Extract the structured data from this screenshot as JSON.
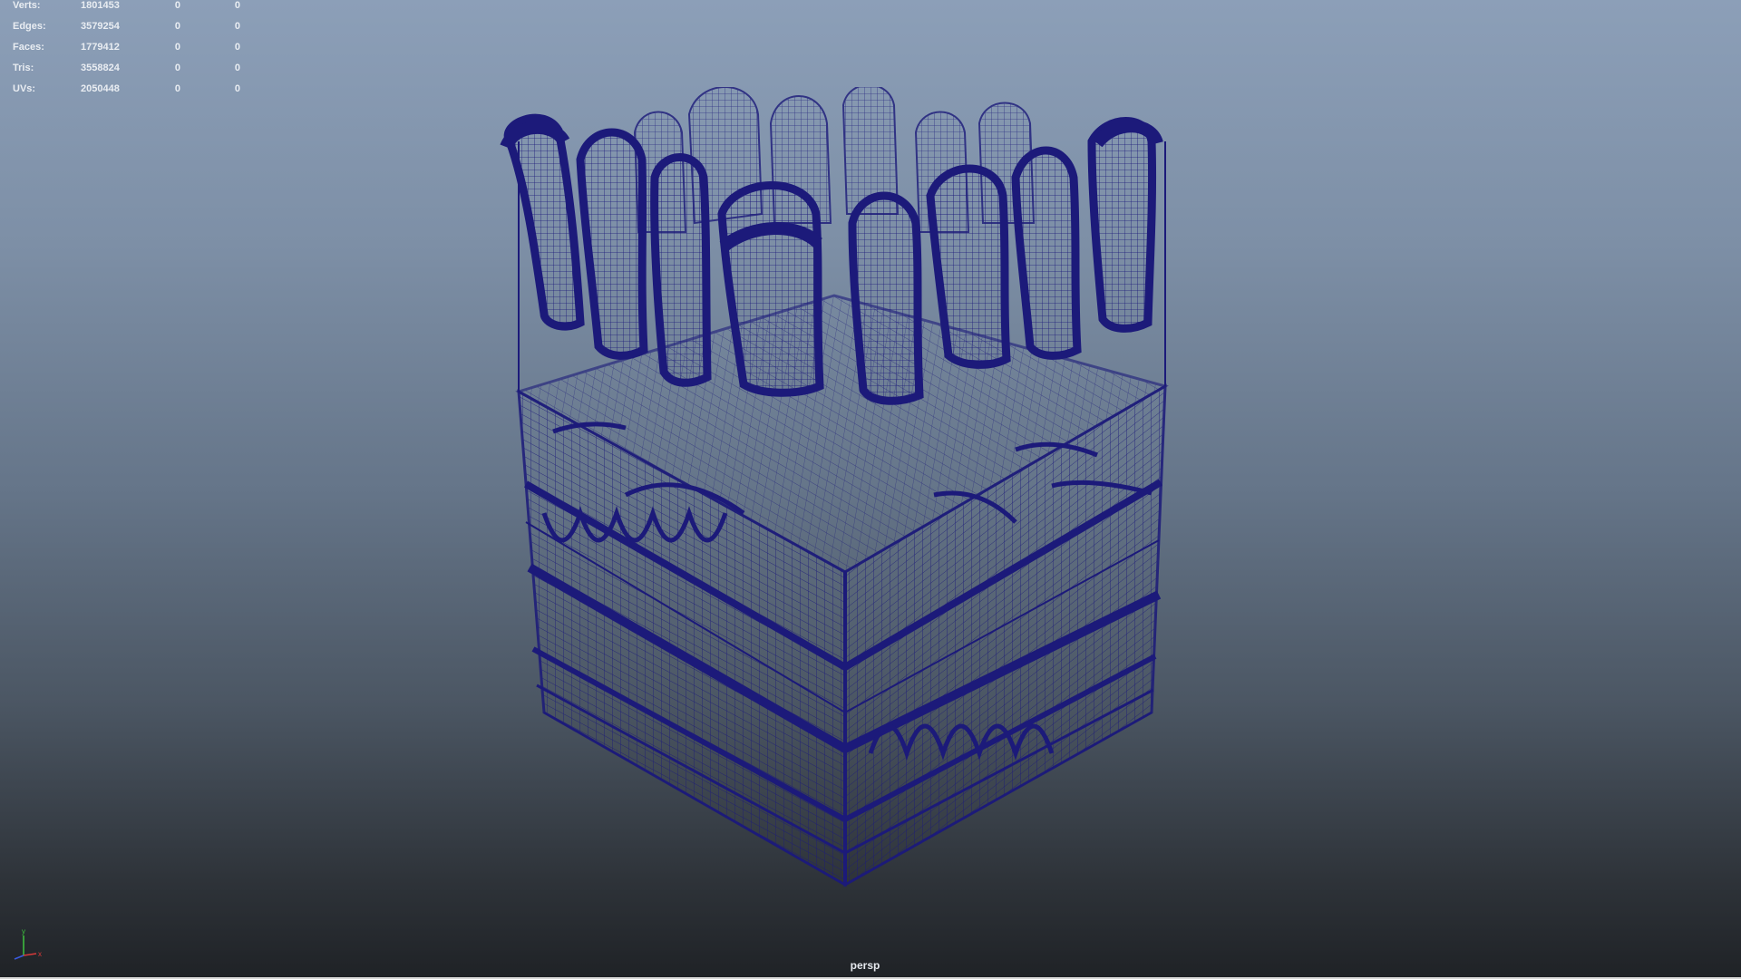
{
  "heads_up_display": {
    "rows": [
      {
        "label": "Verts:",
        "count": "1801453",
        "selected": "0",
        "component": "0"
      },
      {
        "label": "Edges:",
        "count": "3579254",
        "selected": "0",
        "component": "0"
      },
      {
        "label": "Faces:",
        "count": "1779412",
        "selected": "0",
        "component": "0"
      },
      {
        "label": "Tris:",
        "count": "3558824",
        "selected": "0",
        "component": "0"
      },
      {
        "label": "UVs:",
        "count": "2050448",
        "selected": "0",
        "component": "0"
      }
    ]
  },
  "viewport": {
    "camera": "persp",
    "display_mode": "wireframe",
    "wireframe_color": "#1c1a7a",
    "background_top": "#8c9fb8",
    "background_bottom": "#1f2226"
  },
  "axis_gizmo": {
    "x_label": "x",
    "y_label": "y",
    "x_color": "#d83a3a",
    "y_color": "#3ec43e",
    "z_color": "#3a5be0"
  }
}
